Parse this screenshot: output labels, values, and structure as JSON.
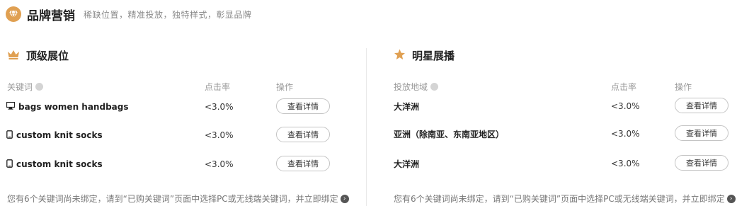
{
  "header": {
    "icon": "diamond-icon",
    "title": "品牌营销",
    "subtitle": "稀缺位置，精准投放，独特样式，彰显品牌",
    "accent_color": "#e0a052"
  },
  "left": {
    "title": "顶级展位",
    "title_icon": "crown-icon",
    "columns": {
      "keyword": "关键词",
      "ctr": "点击率",
      "action": "操作"
    },
    "rows": [
      {
        "device_icon": "desktop-icon",
        "keyword": "bags women handbags",
        "ctr": "<3.0%",
        "button": "查看详情"
      },
      {
        "device_icon": "mobile-icon",
        "keyword": "custom knit socks",
        "ctr": "<3.0%",
        "button": "查看详情"
      },
      {
        "device_icon": "mobile-icon",
        "keyword": "custom knit socks",
        "ctr": "<3.0%",
        "button": "查看详情"
      }
    ],
    "footer": "您有6个关键词尚未绑定，请到“已购关键词”页面中选择PC或无线端关键词，并立即绑定"
  },
  "right": {
    "title": "明星展播",
    "title_icon": "star-icon",
    "columns": {
      "region": "投放地域",
      "ctr": "点击率",
      "action": "操作"
    },
    "rows": [
      {
        "region": "大洋洲",
        "ctr": "<3.0%",
        "button": "查看详情"
      },
      {
        "region": "亚洲（除南亚、东南亚地区）",
        "ctr": "<3.0%",
        "button": "查看详情"
      },
      {
        "region": "大洋洲",
        "ctr": "<3.0%",
        "button": "查看详情"
      }
    ],
    "footer": "您有6个关键词尚未绑定，请到“已购关键词”页面中选择PC或无线端关键词，并立即绑定"
  }
}
